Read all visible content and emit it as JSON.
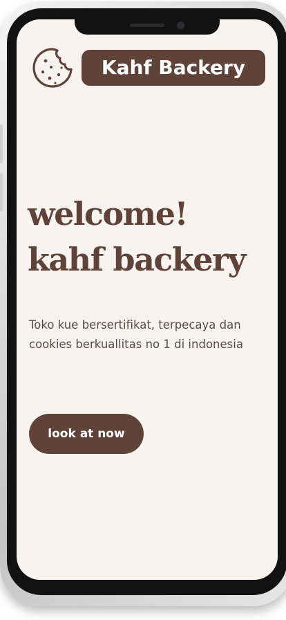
{
  "header": {
    "logo_icon": "cookie-icon",
    "brand_name": "Kahf Backery"
  },
  "hero": {
    "title_line1": "welcome!",
    "title_line2": "kahf backery",
    "desc_line1": "Toko kue bersertifikat, terpecaya dan",
    "desc_line2": "cookies berkuallitas no 1 di indonesia",
    "cta_label": "look at now"
  },
  "colors": {
    "brand_brown": "#5f4338",
    "screen_background": "#f8f3ef",
    "button_text": "#ffffff"
  }
}
